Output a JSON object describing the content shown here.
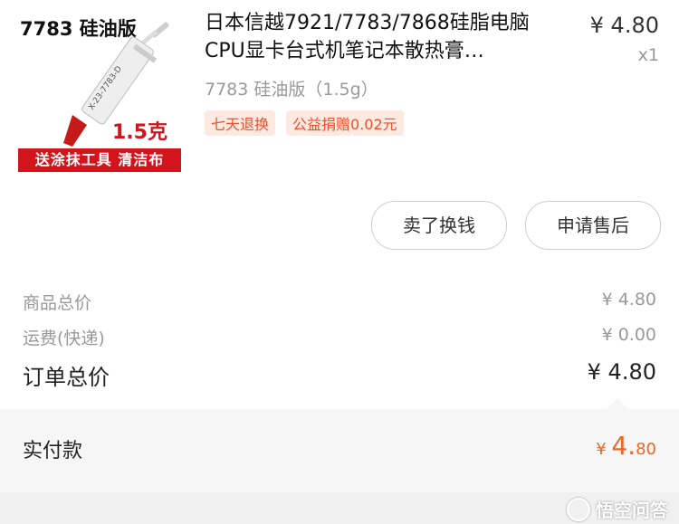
{
  "product": {
    "thumbnail": {
      "brand_text": "7783 硅油版",
      "weight_text": "1.5克",
      "banner_text": "送涂抹工具 清洁布",
      "syringe_text": "X-23-7783-D"
    },
    "title": "日本信越7921/7783/7868硅脂电脑CPU显卡台式机笔记本散热膏…",
    "sku": "7783 硅油版（1.5g）",
    "tags": [
      "七天退换",
      "公益捐赠0.02元"
    ],
    "price": "¥ 4.80",
    "quantity": "x1"
  },
  "actions": {
    "sell_label": "卖了换钱",
    "after_sale_label": "申请售后"
  },
  "summary": {
    "goods_total_label": "商品总价",
    "goods_total_value": "¥ 4.80",
    "shipping_label": "运费(快递)",
    "shipping_value": "¥ 0.00",
    "order_total_label": "订单总价",
    "order_total_value": "¥ 4.80"
  },
  "payment": {
    "label": "实付款",
    "currency": "¥",
    "amount_int": "4.",
    "amount_dec": "80"
  },
  "watermark": {
    "text": "悟空问答"
  },
  "colors": {
    "accent": "#f2641f",
    "tag_bg": "#fde9df",
    "brand_red": "#d4141c"
  }
}
